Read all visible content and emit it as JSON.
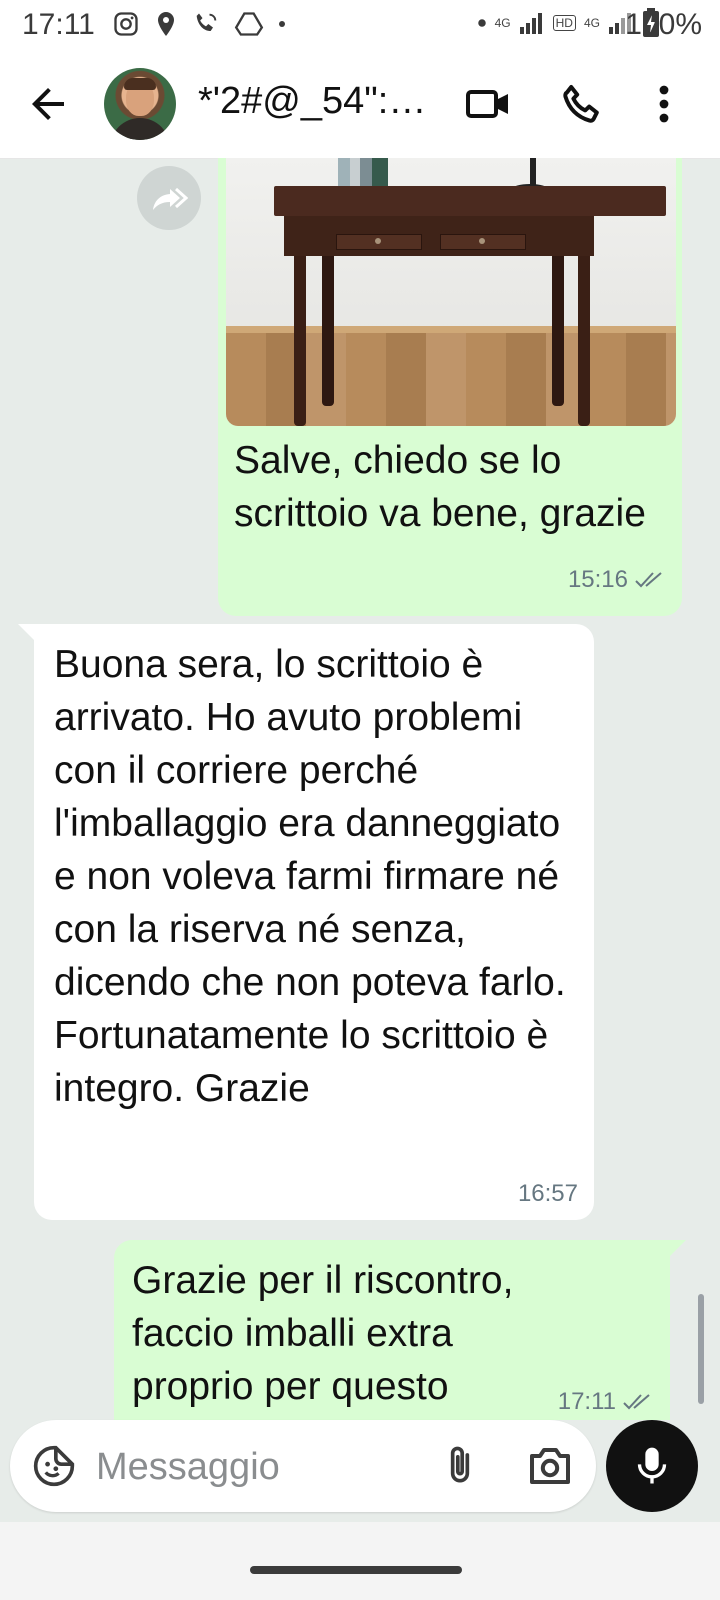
{
  "status_bar": {
    "time": "17:11",
    "battery": "100%",
    "left_icons": [
      "instagram-icon",
      "location-icon",
      "wifi-calling-icon",
      "drive-icon",
      "dot-icon"
    ],
    "right_icons": [
      "dot-icon",
      "signal-4g-icon",
      "hd-icon",
      "signal-4g-icon",
      "battery-charging-icon"
    ],
    "network_4g": "4G",
    "hd": "HD"
  },
  "header": {
    "contact_name": "*'2#@_54\":-…",
    "icons": [
      "back-arrow-icon",
      "video-call-icon",
      "phone-call-icon",
      "more-options-icon"
    ]
  },
  "messages": [
    {
      "direction": "outgoing",
      "has_image": true,
      "text": "Salve, chiedo se lo scrittoio va bene, grazie",
      "time": "15:16",
      "status": "read"
    },
    {
      "direction": "incoming",
      "text": "Buona sera, lo scrittoio è arrivato. Ho avuto problemi con il corriere perché l'imballaggio era danneggiato e non voleva farmi firmare né con la riserva né senza, dicendo che non poteva farlo. Fortunatamente lo scrittoio è integro. Grazie",
      "time": "16:57"
    },
    {
      "direction": "outgoing",
      "text": "Grazie per il riscontro, faccio imballi extra proprio per questo",
      "time": "17:11",
      "status": "read"
    }
  ],
  "composer": {
    "placeholder": "Messaggio",
    "value": ""
  },
  "colors": {
    "outgoing_bubble": "#d9fdd3",
    "incoming_bubble": "#ffffff",
    "chat_background": "#e7ece9",
    "read_ticks": "#667781",
    "mic_button": "#111111"
  }
}
